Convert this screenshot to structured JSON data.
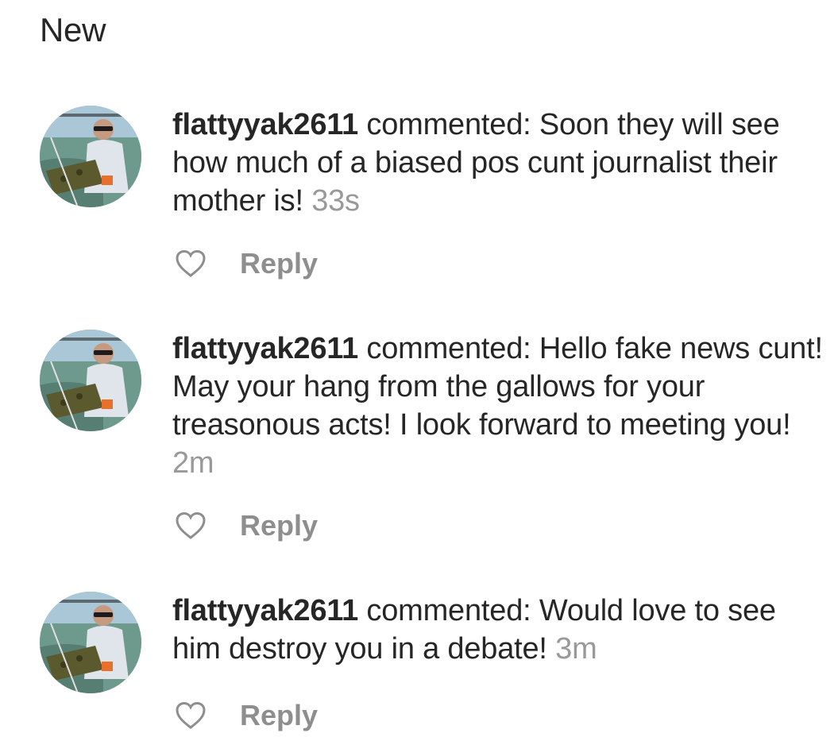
{
  "section": {
    "title": "New"
  },
  "notifications": [
    {
      "username": "flattyyak2611",
      "action": " commented: ",
      "comment": "Soon they will see how much of a biased pos cunt journalist their mother is! ",
      "time": "33s",
      "reply_label": "Reply",
      "avatar_icon": "user-avatar-photo",
      "like_icon": "heart-outline-icon"
    },
    {
      "username": "flattyyak2611",
      "action": " commented: ",
      "comment": "Hello fake news cunt! May your hang from the gallows for your treasonous acts! I look forward to meeting you! ",
      "time": "2m",
      "reply_label": "Reply",
      "avatar_icon": "user-avatar-photo",
      "like_icon": "heart-outline-icon"
    },
    {
      "username": "flattyyak2611",
      "action": " commented: ",
      "comment": "Would love to see him destroy you in a debate! ",
      "time": "3m",
      "reply_label": "Reply",
      "avatar_icon": "user-avatar-photo",
      "like_icon": "heart-outline-icon"
    }
  ],
  "colors": {
    "text": "#262626",
    "secondary": "#999999",
    "reply": "#8e8e8e",
    "heart_outline": "#8e8e8e"
  }
}
